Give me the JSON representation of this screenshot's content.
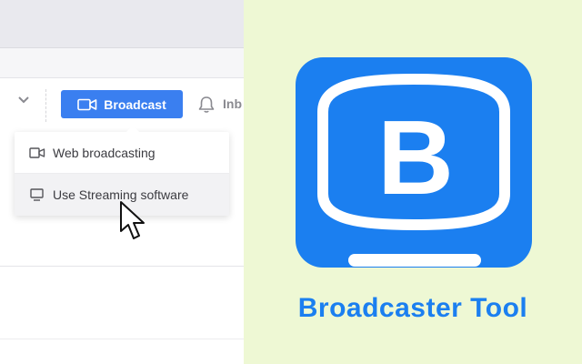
{
  "toolbar": {
    "broadcast_label": "Broadcast",
    "inbox_label_partial": "Inb"
  },
  "dropdown": {
    "items": [
      {
        "label": "Web broadcasting",
        "icon": "video-camera-icon"
      },
      {
        "label": "Use Streaming software",
        "icon": "monitor-icon"
      }
    ],
    "hovered_index": 1
  },
  "branding": {
    "logo_letter": "B",
    "caption": "Broadcaster Tool"
  },
  "colors": {
    "accent_blue": "#3a7ff0",
    "brand_blue": "#1b7ff0",
    "background_green": "#eef8d4"
  }
}
